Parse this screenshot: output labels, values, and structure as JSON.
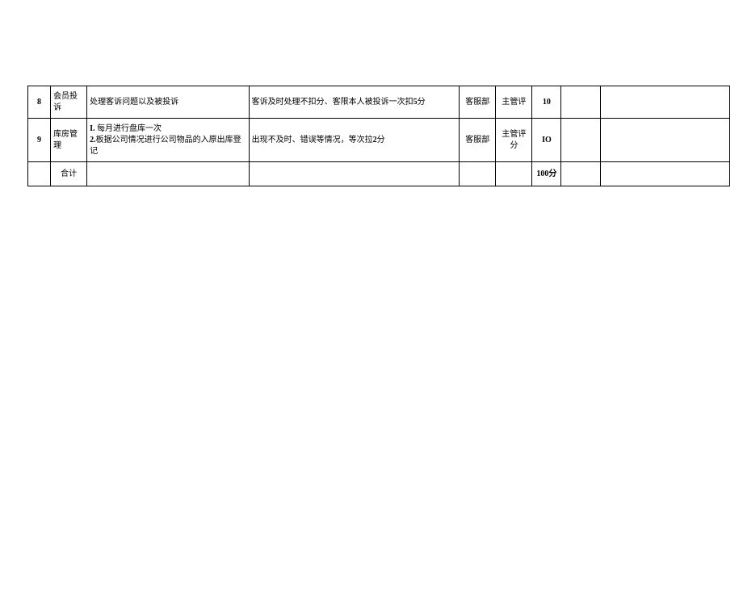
{
  "rows": [
    {
      "num": "8",
      "item": "会员投诉",
      "desc": "处理客诉问题以及被投诉",
      "criteria_pre": "客诉及时处理不扣分、客限本人被投诉一次扣",
      "criteria_bold": "5",
      "criteria_post": "分",
      "dept": "客服部",
      "eval": "主管评",
      "score": "10"
    },
    {
      "num": "9",
      "item": "库房管理",
      "desc_line1_pre": "I.",
      "desc_line1": " 每月进行盘库一次",
      "desc_line2_pre": "2.",
      "desc_line2": "板据公司情况进行公司物品的入原出库登记",
      "criteria_pre": "出现不及时、错误等情况，等次拉",
      "criteria_bold": "2",
      "criteria_post": "分",
      "dept": "客服部",
      "eval": "主管评分",
      "score": "IO"
    }
  ],
  "total": {
    "label": "合计",
    "score": "100分"
  }
}
